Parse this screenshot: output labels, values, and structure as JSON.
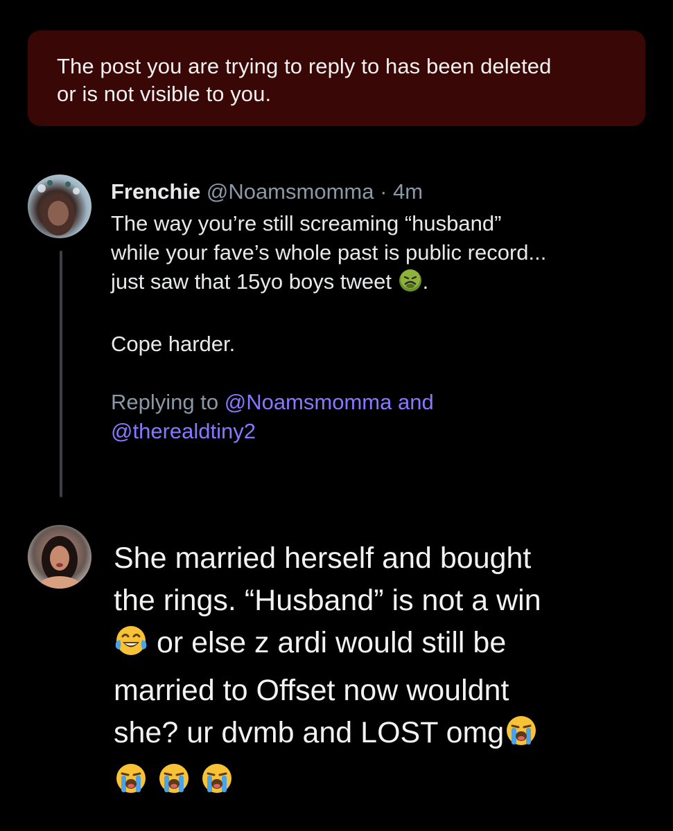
{
  "banner": {
    "line1": "The post you are trying to reply to has been deleted",
    "line2": "or is not visible to you."
  },
  "tweet": {
    "display_name": "Frenchie",
    "handle": "@Noamsmomma",
    "separator": "·",
    "time": "4m",
    "body_line1": "The way you’re still screaming “husband”",
    "body_line2": "while your fave’s whole past is public record...",
    "body_line3_before_emoji": "just saw that 15yo boys tweet",
    "body_line3_emoji": "nauseated-face-emoji",
    "body_line3_after_emoji": ".",
    "body_line4": "Cope harder.",
    "replying_prefix": "Replying to",
    "reply_mention1": "@Noamsmomma",
    "reply_and": "and",
    "reply_mention2": "@therealdtiny2"
  },
  "reply": {
    "line1": "She married herself and bought",
    "line2": "the rings. “Husband” is not a win",
    "line3_emoji": "face-with-tears-of-joy-emoji",
    "line3_text": "or else z ardi would still be",
    "line4": "married to Offset now wouldnt",
    "line5_text": "she? ur dvmb and LOST omg",
    "line5_emoji": "loudly-crying-face-emoji",
    "line6_emojis": [
      "loudly-crying-face-emoji",
      "loudly-crying-face-emoji",
      "loudly-crying-face-emoji"
    ]
  },
  "colors": {
    "background": "#000000",
    "banner_bg": "#3a0707",
    "text_primary": "#e7e9ea",
    "text_secondary": "#8b98a5",
    "mention": "#8877ff",
    "thread_line": "#3e4144"
  }
}
